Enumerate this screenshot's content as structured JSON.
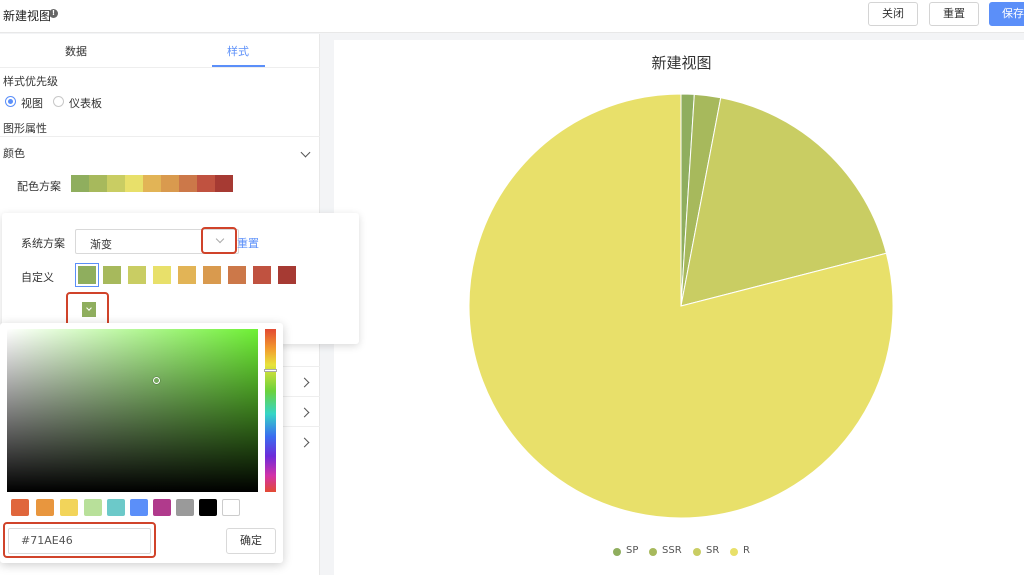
{
  "header": {
    "title": "新建视图",
    "close_label": "关闭",
    "reset_label": "重置",
    "save_label": "保存"
  },
  "panel": {
    "tabs": [
      {
        "label": "数据",
        "active": false
      },
      {
        "label": "样式",
        "active": true
      }
    ],
    "style_priority_label": "样式优先级",
    "priority_options": [
      {
        "label": "视图",
        "checked": true
      },
      {
        "label": "仪表板",
        "checked": false
      }
    ],
    "shape_props_label": "图形属性",
    "color_section_label": "颜色",
    "color_scheme_label": "配色方案",
    "scheme_colors": [
      "#8fae5e",
      "#a7b95c",
      "#c9cd63",
      "#e8e06a",
      "#e2b456",
      "#d99a4e",
      "#cc7849",
      "#c05240",
      "#a63a33"
    ]
  },
  "scheme_popover": {
    "system_scheme_label": "系统方案",
    "system_scheme_value": "渐变",
    "reset_link": "重置",
    "custom_label": "自定义",
    "custom_colors": [
      "#8fae5e",
      "#a7b95c",
      "#c9cd63",
      "#e8e06a",
      "#e2b456",
      "#d99a4e",
      "#cc7849",
      "#c05240",
      "#a63a33"
    ]
  },
  "color_picker": {
    "preset_colors": [
      "#e0663c",
      "#e8963e",
      "#f2d45a",
      "#b8e09a",
      "#6cc9c9",
      "#5b8ff9",
      "#b03a8c",
      "#9a9a9a",
      "#000000",
      "#ffffff"
    ],
    "hex_value": "#71AE46",
    "confirm_label": "确定"
  },
  "chart_data": {
    "type": "pie",
    "title": "新建视图",
    "categories": [
      "SP",
      "SSR",
      "SR",
      "R"
    ],
    "values": [
      1,
      2,
      18,
      79
    ],
    "colors": [
      "#8fae5e",
      "#a7b95c",
      "#c9cd63",
      "#e8e06a"
    ],
    "legend": "bottom"
  }
}
